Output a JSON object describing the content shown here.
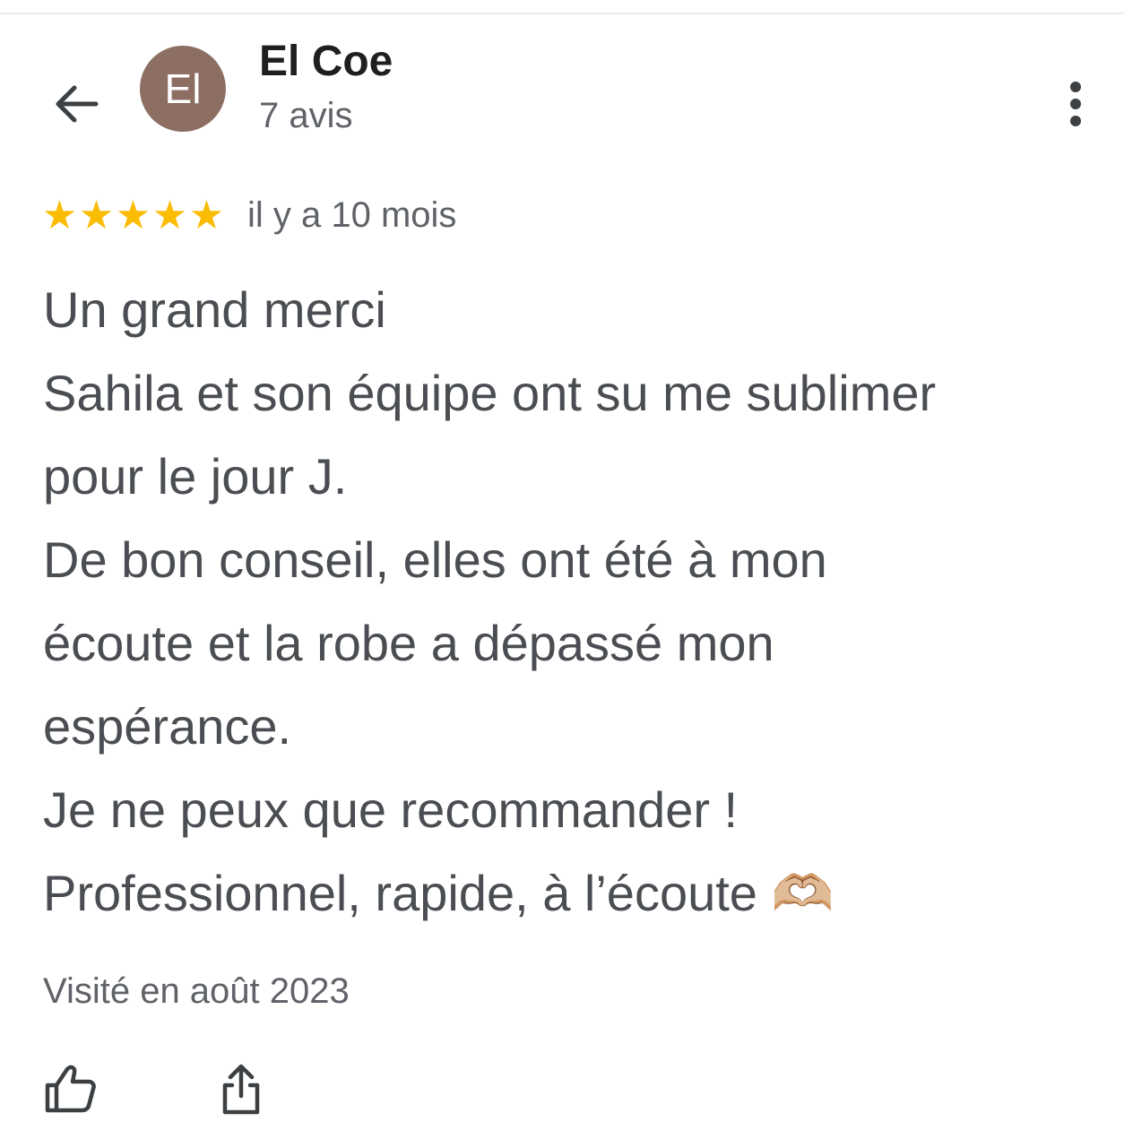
{
  "header": {
    "back_icon": "arrow-left-icon",
    "avatar_initials": "El",
    "avatar_color": "#8d6e63",
    "reviewer_name": "El Coe",
    "review_count": "7 avis",
    "more_icon": "more-vertical-icon"
  },
  "review": {
    "rating": 5,
    "rating_max": 5,
    "star_color": "#fbbc04",
    "date": "il y a 10 mois",
    "lines": [
      "Un grand merci",
      "Sahila et son équipe ont su me sublimer",
      "pour le jour J.",
      "De bon conseil, elles ont été à mon",
      "écoute et la robe a dépassé mon",
      "espérance.",
      "Je ne peux que recommander !",
      "Professionnel, rapide, à l’écoute 🫶🏼"
    ],
    "visit": "Visité en août 2023"
  },
  "actions": {
    "like_icon": "thumbs-up-icon",
    "share_icon": "share-icon"
  }
}
